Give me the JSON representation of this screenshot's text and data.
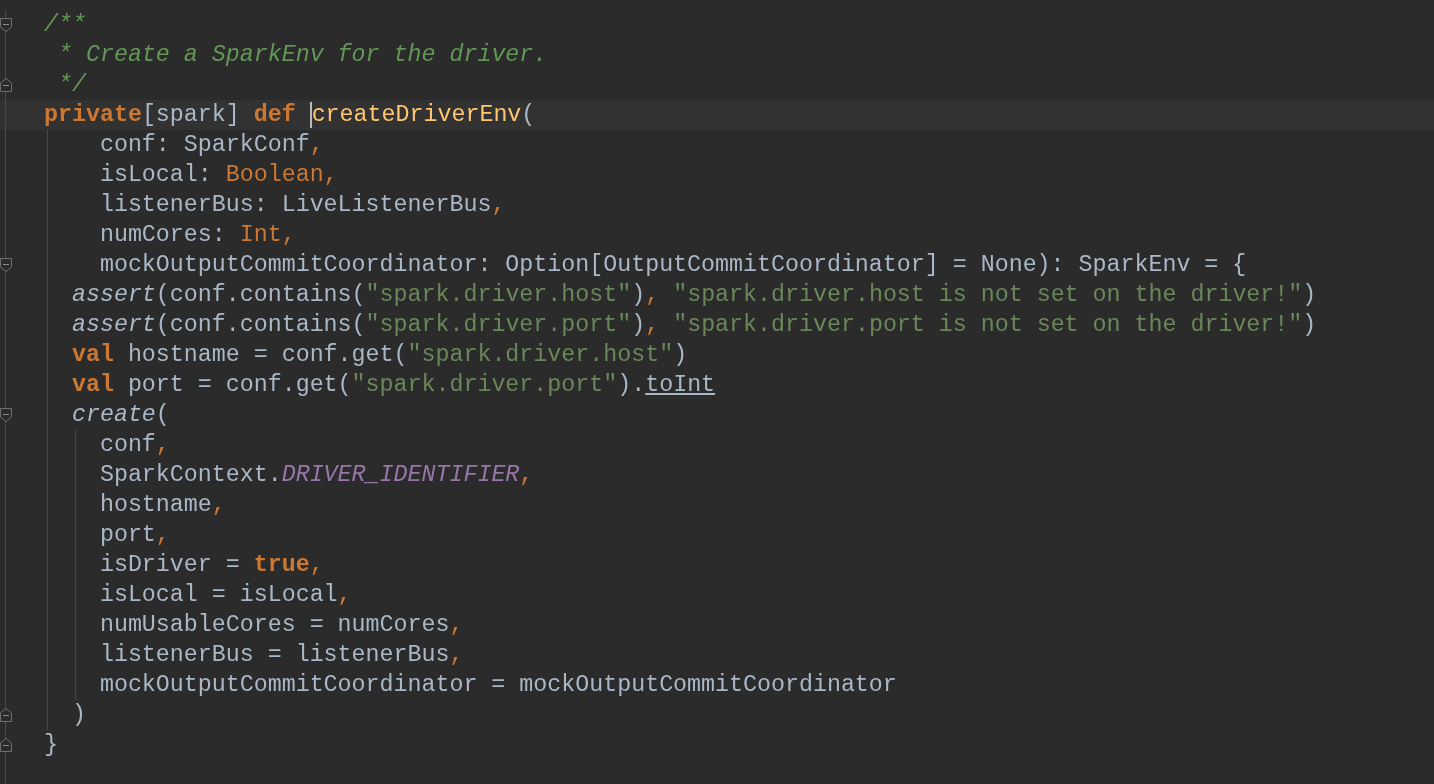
{
  "editor": {
    "lines": [
      {
        "fold_start": true,
        "fold_end": false,
        "current": false,
        "outer_guide": false,
        "inner_guide": false,
        "tokens": [
          {
            "kind": "comment",
            "text": "/**"
          }
        ]
      },
      {
        "fold_start": false,
        "fold_end": false,
        "current": false,
        "outer_guide": false,
        "inner_guide": false,
        "tokens": [
          {
            "kind": "comment",
            "text": " * Create a SparkEnv for the driver."
          }
        ]
      },
      {
        "fold_start": false,
        "fold_end": true,
        "current": false,
        "outer_guide": false,
        "inner_guide": false,
        "tokens": [
          {
            "kind": "comment",
            "text": " */"
          }
        ]
      },
      {
        "fold_start": false,
        "fold_end": false,
        "current": true,
        "outer_guide": false,
        "inner_guide": false,
        "tokens": [
          {
            "kind": "keyword",
            "text": "private"
          },
          {
            "kind": "plain",
            "text": "[spark] "
          },
          {
            "kind": "keyword",
            "text": "def "
          },
          {
            "kind": "caret"
          },
          {
            "kind": "definition",
            "text": "createDriverEnv"
          },
          {
            "kind": "plain",
            "text": "("
          }
        ]
      },
      {
        "fold_start": false,
        "fold_end": false,
        "current": false,
        "outer_guide": true,
        "inner_guide": false,
        "tokens": [
          {
            "kind": "plain",
            "text": "    conf: SparkConf"
          },
          {
            "kind": "punct",
            "text": ","
          }
        ]
      },
      {
        "fold_start": false,
        "fold_end": false,
        "current": false,
        "outer_guide": true,
        "inner_guide": false,
        "tokens": [
          {
            "kind": "plain",
            "text": "    isLocal: "
          },
          {
            "kind": "type",
            "text": "Boolean"
          },
          {
            "kind": "punct",
            "text": ","
          }
        ]
      },
      {
        "fold_start": false,
        "fold_end": false,
        "current": false,
        "outer_guide": true,
        "inner_guide": false,
        "tokens": [
          {
            "kind": "plain",
            "text": "    listenerBus: LiveListenerBus"
          },
          {
            "kind": "punct",
            "text": ","
          }
        ]
      },
      {
        "fold_start": false,
        "fold_end": false,
        "current": false,
        "outer_guide": true,
        "inner_guide": false,
        "tokens": [
          {
            "kind": "plain",
            "text": "    numCores: "
          },
          {
            "kind": "type",
            "text": "Int"
          },
          {
            "kind": "punct",
            "text": ","
          }
        ]
      },
      {
        "fold_start": true,
        "fold_end": false,
        "current": false,
        "outer_guide": true,
        "inner_guide": false,
        "tokens": [
          {
            "kind": "plain",
            "text": "    mockOutputCommitCoordinator: Option[OutputCommitCoordinator] = None): SparkEnv = {"
          }
        ]
      },
      {
        "fold_start": false,
        "fold_end": false,
        "current": false,
        "outer_guide": true,
        "inner_guide": false,
        "tokens": [
          {
            "kind": "call",
            "text": "  assert"
          },
          {
            "kind": "plain",
            "text": "(conf.contains("
          },
          {
            "kind": "string",
            "text": "\"spark.driver.host\""
          },
          {
            "kind": "plain",
            "text": ")"
          },
          {
            "kind": "punct",
            "text": ", "
          },
          {
            "kind": "string",
            "text": "\"spark.driver.host is not set on the driver!\""
          },
          {
            "kind": "plain",
            "text": ")"
          }
        ]
      },
      {
        "fold_start": false,
        "fold_end": false,
        "current": false,
        "outer_guide": true,
        "inner_guide": false,
        "tokens": [
          {
            "kind": "call",
            "text": "  assert"
          },
          {
            "kind": "plain",
            "text": "(conf.contains("
          },
          {
            "kind": "string",
            "text": "\"spark.driver.port\""
          },
          {
            "kind": "plain",
            "text": ")"
          },
          {
            "kind": "punct",
            "text": ", "
          },
          {
            "kind": "string",
            "text": "\"spark.driver.port is not set on the driver!\""
          },
          {
            "kind": "plain",
            "text": ")"
          }
        ]
      },
      {
        "fold_start": false,
        "fold_end": false,
        "current": false,
        "outer_guide": true,
        "inner_guide": false,
        "tokens": [
          {
            "kind": "keyword",
            "text": "  val "
          },
          {
            "kind": "plain",
            "text": "hostname = conf.get("
          },
          {
            "kind": "string",
            "text": "\"spark.driver.host\""
          },
          {
            "kind": "plain",
            "text": ")"
          }
        ]
      },
      {
        "fold_start": false,
        "fold_end": false,
        "current": false,
        "outer_guide": true,
        "inner_guide": false,
        "tokens": [
          {
            "kind": "keyword",
            "text": "  val "
          },
          {
            "kind": "plain",
            "text": "port = conf.get("
          },
          {
            "kind": "string",
            "text": "\"spark.driver.port\""
          },
          {
            "kind": "plain",
            "text": ")."
          },
          {
            "kind": "underlined",
            "text": "toInt"
          }
        ]
      },
      {
        "fold_start": true,
        "fold_end": false,
        "current": false,
        "outer_guide": true,
        "inner_guide": false,
        "tokens": [
          {
            "kind": "call",
            "text": "  create"
          },
          {
            "kind": "plain",
            "text": "("
          }
        ]
      },
      {
        "fold_start": false,
        "fold_end": false,
        "current": false,
        "outer_guide": true,
        "inner_guide": true,
        "tokens": [
          {
            "kind": "plain",
            "text": "    conf"
          },
          {
            "kind": "punct",
            "text": ","
          }
        ]
      },
      {
        "fold_start": false,
        "fold_end": false,
        "current": false,
        "outer_guide": true,
        "inner_guide": true,
        "tokens": [
          {
            "kind": "plain",
            "text": "    SparkContext."
          },
          {
            "kind": "constant",
            "text": "DRIVER_IDENTIFIER"
          },
          {
            "kind": "punct",
            "text": ","
          }
        ]
      },
      {
        "fold_start": false,
        "fold_end": false,
        "current": false,
        "outer_guide": true,
        "inner_guide": true,
        "tokens": [
          {
            "kind": "plain",
            "text": "    hostname"
          },
          {
            "kind": "punct",
            "text": ","
          }
        ]
      },
      {
        "fold_start": false,
        "fold_end": false,
        "current": false,
        "outer_guide": true,
        "inner_guide": true,
        "tokens": [
          {
            "kind": "plain",
            "text": "    port"
          },
          {
            "kind": "punct",
            "text": ","
          }
        ]
      },
      {
        "fold_start": false,
        "fold_end": false,
        "current": false,
        "outer_guide": true,
        "inner_guide": true,
        "tokens": [
          {
            "kind": "plain",
            "text": "    isDriver = "
          },
          {
            "kind": "keyword",
            "text": "true"
          },
          {
            "kind": "punct",
            "text": ","
          }
        ]
      },
      {
        "fold_start": false,
        "fold_end": false,
        "current": false,
        "outer_guide": true,
        "inner_guide": true,
        "tokens": [
          {
            "kind": "plain",
            "text": "    isLocal = isLocal"
          },
          {
            "kind": "punct",
            "text": ","
          }
        ]
      },
      {
        "fold_start": false,
        "fold_end": false,
        "current": false,
        "outer_guide": true,
        "inner_guide": true,
        "tokens": [
          {
            "kind": "plain",
            "text": "    numUsableCores = numCores"
          },
          {
            "kind": "punct",
            "text": ","
          }
        ]
      },
      {
        "fold_start": false,
        "fold_end": false,
        "current": false,
        "outer_guide": true,
        "inner_guide": true,
        "tokens": [
          {
            "kind": "plain",
            "text": "    listenerBus = listenerBus"
          },
          {
            "kind": "punct",
            "text": ","
          }
        ]
      },
      {
        "fold_start": false,
        "fold_end": false,
        "current": false,
        "outer_guide": true,
        "inner_guide": true,
        "tokens": [
          {
            "kind": "plain",
            "text": "    mockOutputCommitCoordinator = mockOutputCommitCoordinator"
          }
        ]
      },
      {
        "fold_start": false,
        "fold_end": true,
        "current": false,
        "outer_guide": true,
        "inner_guide": false,
        "tokens": [
          {
            "kind": "plain",
            "text": "  )"
          }
        ]
      },
      {
        "fold_start": false,
        "fold_end": true,
        "current": false,
        "outer_guide": false,
        "inner_guide": false,
        "tokens": [
          {
            "kind": "plain",
            "text": "}"
          }
        ]
      }
    ]
  }
}
